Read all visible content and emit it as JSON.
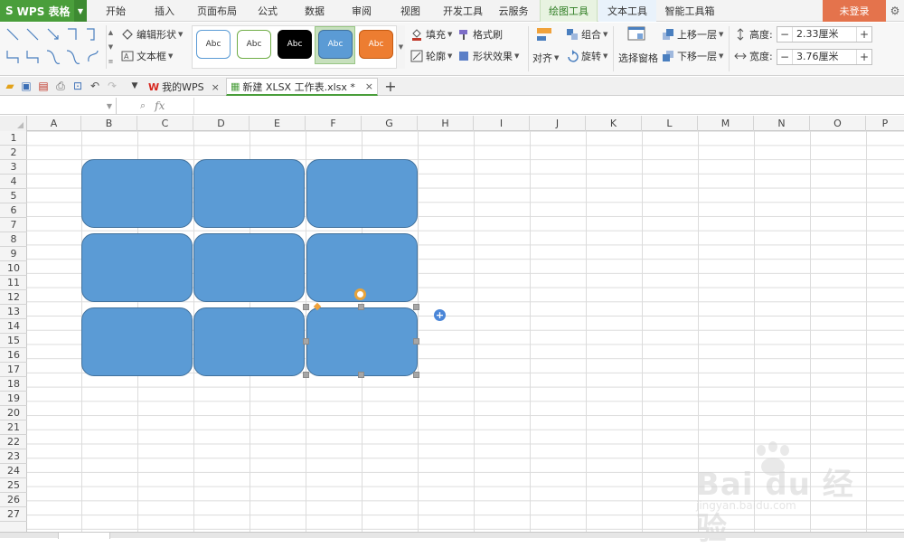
{
  "app": {
    "title": "WPS 表格",
    "logo": "S"
  },
  "menu": {
    "tabs": [
      {
        "label": "开始"
      },
      {
        "label": "插入"
      },
      {
        "label": "页面布局"
      },
      {
        "label": "公式"
      },
      {
        "label": "数据"
      },
      {
        "label": "审阅"
      },
      {
        "label": "视图"
      },
      {
        "label": "开发工具"
      },
      {
        "label": "云服务"
      },
      {
        "label": "绘图工具",
        "state": "active"
      },
      {
        "label": "文本工具"
      },
      {
        "label": "智能工具箱"
      }
    ],
    "login": "未登录"
  },
  "ribbon": {
    "edit_shape": "编辑形状",
    "text_box": "文本框",
    "styles": [
      {
        "label": "Abc",
        "fill": "#ffffff",
        "border": "#5b9bd5",
        "text": "#333333"
      },
      {
        "label": "Abc",
        "fill": "#ffffff",
        "border": "#70ad47",
        "text": "#333333"
      },
      {
        "label": "Abc",
        "fill": "#000000",
        "border": "#000000",
        "text": "#ffffff"
      },
      {
        "label": "Abc",
        "fill": "#5b9bd5",
        "border": "#41719c",
        "text": "#ffffff",
        "selected": true
      },
      {
        "label": "Abc",
        "fill": "#ed7d31",
        "border": "#c55a11",
        "text": "#ffffff"
      }
    ],
    "fill": "填充",
    "format_brush": "格式刷",
    "outline": "轮廓",
    "shape_effect": "形状效果",
    "align": "对齐",
    "group": "组合",
    "rotate": "旋转",
    "selection_pane": "选择窗格",
    "bring_forward": "上移一层",
    "send_backward": "下移一层",
    "height_label": "高度:",
    "height_value": "2.33厘米",
    "width_label": "宽度:",
    "width_value": "3.76厘米"
  },
  "doc_tabs": [
    {
      "label": "我的WPS"
    },
    {
      "label": "新建 XLSX 工作表.xlsx *",
      "active": true
    }
  ],
  "formula_bar": {
    "fx": "fx"
  },
  "grid": {
    "columns": [
      "A",
      "B",
      "C",
      "D",
      "E",
      "F",
      "G",
      "H",
      "I",
      "J",
      "K",
      "L",
      "M",
      "N",
      "O",
      "P"
    ],
    "rows": [
      "1",
      "2",
      "3",
      "4",
      "5",
      "6",
      "7",
      "8",
      "9",
      "10",
      "11",
      "12",
      "13",
      "14",
      "15",
      "16",
      "17",
      "18",
      "19",
      "20",
      "21",
      "22",
      "23",
      "24",
      "25",
      "26",
      "27"
    ],
    "shape_color": "#5b9bd5",
    "shape_border": "#41719c"
  },
  "watermark": {
    "text": "Bai du 经验",
    "sub": "jingyan.baidu.com"
  }
}
